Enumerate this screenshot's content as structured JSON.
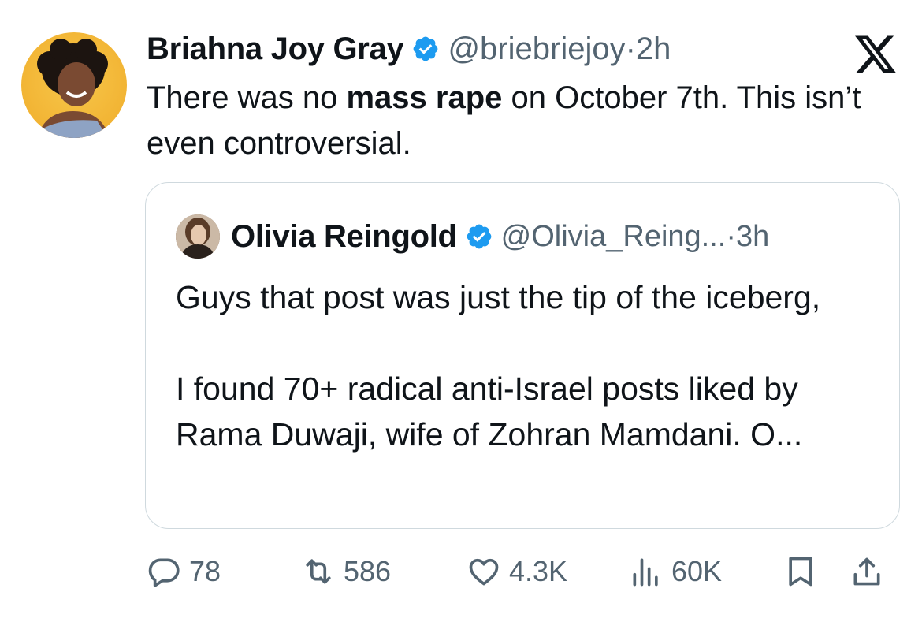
{
  "tweet": {
    "author_name": "Briahna Joy Gray",
    "handle": "@briebriejoy",
    "separator": " · ",
    "time": "2h",
    "text_part1": "There was no ",
    "text_bold": "mass rape",
    "text_part2": " on October 7th. This isn’t even controversial."
  },
  "quoted": {
    "author_name": "Olivia Reingold",
    "handle": "@Olivia_Reing...",
    "separator": " · ",
    "time": "3h",
    "paragraph1": "Guys that post was just the tip of the iceberg,",
    "paragraph2": "I found 70+ radical anti-Israel posts liked by Rama Duwaji, wife of Zohran Mamdani. O..."
  },
  "actions": {
    "replies": "78",
    "reposts": "586",
    "likes": "4.3K",
    "views": "60K"
  },
  "icons": {
    "brand": "x-logo-icon",
    "verified": "verified-badge-icon",
    "reply": "reply-icon",
    "repost": "repost-icon",
    "like": "heart-icon",
    "views": "views-icon",
    "bookmark": "bookmark-icon",
    "share": "share-icon"
  },
  "colors": {
    "verified_blue": "#1d9bf0",
    "text_primary": "#0f1419",
    "text_secondary": "#536471",
    "border": "#cfd9de"
  }
}
